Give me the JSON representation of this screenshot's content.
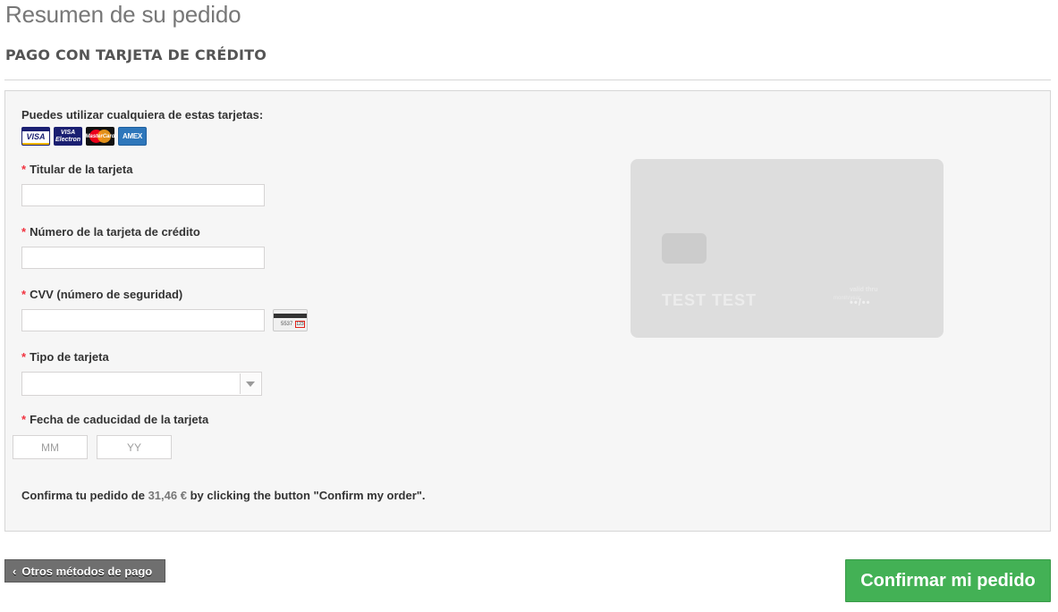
{
  "header": {
    "title": "Resumen de su pedido",
    "section": "PAGO CON TARJETA DE CRÉDITO"
  },
  "form": {
    "cards_label": "Puedes utilizar cualquiera de estas tarjetas:",
    "card_logos": [
      {
        "name": "visa-logo",
        "text": "VISA"
      },
      {
        "name": "visa-electron-logo",
        "text": "VISA Electron"
      },
      {
        "name": "mastercard-logo",
        "text": "MasterCard"
      },
      {
        "name": "amex-logo",
        "text": "AMEX"
      }
    ],
    "required_mark": "*",
    "holder_label": "Titular de la tarjeta",
    "holder_value": "",
    "number_label": "Número de la tarjeta de crédito",
    "number_value": "",
    "cvv_label": "CVV (número de seguridad)",
    "cvv_value": "",
    "cvv_icon_digits": "5537",
    "cvv_icon_code": "123",
    "type_label": "Tipo de tarjeta",
    "type_selected": "",
    "expiry_label": "Fecha de caducidad de la tarjeta",
    "month_placeholder": "MM",
    "year_placeholder": "YY",
    "confirm_prefix": "Confirma tu pedido de",
    "confirm_amount": "31,46 €",
    "confirm_suffix": "by clicking the button \"Confirm my order\"."
  },
  "card_preview": {
    "name": "TEST  TEST",
    "valid_label": "valid thru",
    "month_label": "month/year",
    "expiry": "••/••"
  },
  "footer": {
    "back_label": "Otros métodos de pago",
    "confirm_label": "Confirmar mi pedido"
  },
  "colors": {
    "accent_green": "#43b155",
    "required_red": "#f13340",
    "back_button_gray": "#6f6f6f"
  }
}
